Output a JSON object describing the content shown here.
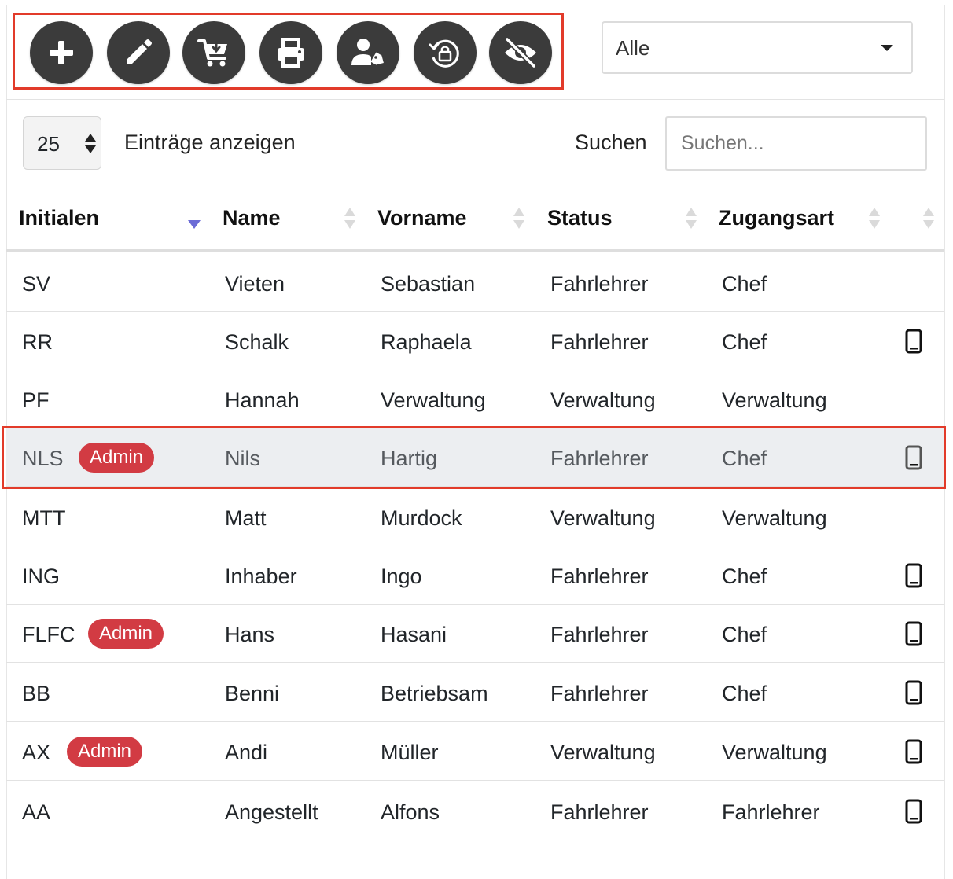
{
  "toolbar": {
    "buttons": [
      {
        "icon": "plus-icon"
      },
      {
        "icon": "pencil-icon"
      },
      {
        "icon": "cart-download-icon"
      },
      {
        "icon": "printer-icon"
      },
      {
        "icon": "user-tag-icon"
      },
      {
        "icon": "rotate-lock-icon"
      },
      {
        "icon": "eye-slash-icon"
      }
    ],
    "filter": {
      "selected": "Alle"
    }
  },
  "controls": {
    "page_length": "25",
    "page_length_label": "Einträge anzeigen",
    "search_label": "Suchen",
    "search_placeholder": "Suchen..."
  },
  "table": {
    "columns": [
      "Initialen",
      "Name",
      "Vorname",
      "Status",
      "Zugangsart"
    ],
    "rows": [
      {
        "initials": "SV",
        "name": "Vieten",
        "vorname": "Sebastian",
        "status": "Fahrlehrer",
        "zugangsart": "Chef",
        "badge": "",
        "phone": false
      },
      {
        "initials": "RR",
        "name": "Schalk",
        "vorname": "Raphaela",
        "status": "Fahrlehrer",
        "zugangsart": "Chef",
        "badge": "",
        "phone": true
      },
      {
        "initials": "PF",
        "name": "Hannah",
        "vorname": "Verwaltung",
        "status": "Verwaltung",
        "zugangsart": "Verwaltung",
        "badge": "",
        "phone": false
      },
      {
        "initials": "NLS",
        "name": "Nils",
        "vorname": "Hartig",
        "status": "Fahrlehrer",
        "zugangsart": "Chef",
        "badge": "Admin",
        "phone": true
      },
      {
        "initials": "MTT",
        "name": "Matt",
        "vorname": "Murdock",
        "status": "Verwaltung",
        "zugangsart": "Verwaltung",
        "badge": "",
        "phone": false
      },
      {
        "initials": "ING",
        "name": "Inhaber",
        "vorname": "Ingo",
        "status": "Fahrlehrer",
        "zugangsart": "Chef",
        "badge": "",
        "phone": true
      },
      {
        "initials": "FLFC",
        "name": "Hans",
        "vorname": "Hasani",
        "status": "Fahrlehrer",
        "zugangsart": "Chef",
        "badge": "Admin",
        "phone": true
      },
      {
        "initials": "BB",
        "name": "Benni",
        "vorname": "Betriebsam",
        "status": "Fahrlehrer",
        "zugangsart": "Chef",
        "badge": "",
        "phone": true
      },
      {
        "initials": "AX",
        "name": "Andi",
        "vorname": "Müller",
        "status": "Verwaltung",
        "zugangsart": "Verwaltung",
        "badge": "Admin",
        "phone": true
      },
      {
        "initials": "AA",
        "name": "Angestellt",
        "vorname": "Alfons",
        "status": "Fahrlehrer",
        "zugangsart": "Fahrlehrer",
        "badge": "",
        "phone": true
      }
    ]
  },
  "colors": {
    "highlight": "#e23b2a",
    "badge": "#d23b43",
    "button": "#3b3b3b",
    "selected_row": "#eceef1"
  }
}
